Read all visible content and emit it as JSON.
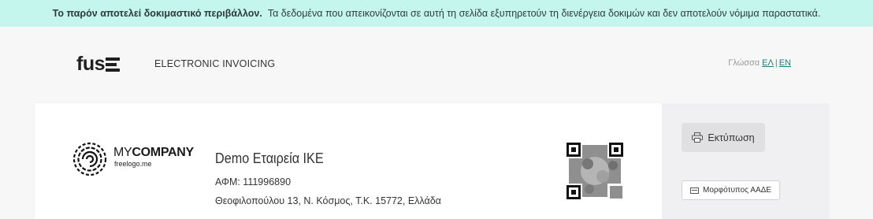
{
  "banner": {
    "bold_text": "Το παρόν αποτελεί δοκιμαστικό περιβάλλον.",
    "text": "Τα δεδομένα που απεικονίζονται σε αυτή τη σελίδα εξυπηρετούν τη διενέργεια δοκιμών και δεν αποτελούν νόμιμα παραστατικά."
  },
  "header": {
    "logo_text": "fus",
    "product": "ELECTRONIC INVOICING",
    "language_label": "Γλώσσα",
    "languages": [
      "ΕΛ",
      "EN"
    ]
  },
  "issuer": {
    "logo_main_light": "MY",
    "logo_main_bold": "COMPANY",
    "logo_sub": "freelogo.me",
    "name": "Demo Εταιρεία ΙΚΕ",
    "vat": "ΑΦΜ: 111996890",
    "address": "Θεοφιλοπούλου 13, Ν. Κόσμος, Τ.Κ. 15772, Ελλάδα"
  },
  "actions": {
    "print_label": "Εκτύπωση",
    "aade_label": "Μορφότυπος ΑΑΔΕ"
  },
  "colors": {
    "banner_bg": "#c4f6ee",
    "link": "#1a7f7a"
  }
}
